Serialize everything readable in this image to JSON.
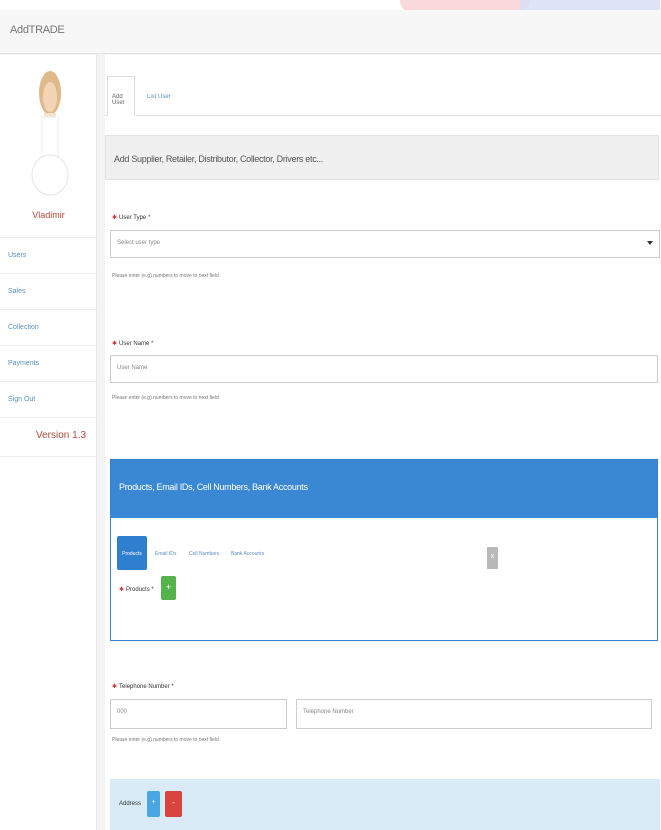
{
  "app": {
    "title": "AddTRADE"
  },
  "user": {
    "name": "Vladimir"
  },
  "sidebar": {
    "items": [
      {
        "label": "Users"
      },
      {
        "label": "Sales"
      },
      {
        "label": "Collection"
      },
      {
        "label": "Payments"
      },
      {
        "label": "Sign Out"
      }
    ],
    "version": "Version 1.3"
  },
  "tabs": [
    {
      "label": "Add User"
    },
    {
      "label": "List User"
    }
  ],
  "heading": "Add Supplier, Retailer, Distributor, Collector, Drivers etc...",
  "user_type": {
    "label": "User Type",
    "required": "*",
    "selected": "Select user type",
    "help": "Please enter (e.g) numbers to move to next field"
  },
  "user_name": {
    "label": "User Name",
    "required": "*",
    "placeholder": "User Name",
    "help": "Please enter (e.g) numbers to move to next field"
  },
  "panel": {
    "title": "Products, Email IDs, Cell Numbers, Bank Accounts",
    "tabs": [
      {
        "label": "Products"
      },
      {
        "label": "Email IDs"
      },
      {
        "label": "Cell Numbers"
      },
      {
        "label": "Bank Accounts"
      }
    ],
    "products_label": "Products",
    "products_required": "*",
    "plus": "+",
    "close": "x"
  },
  "telephone": {
    "label": "Telephone Number",
    "required": "*",
    "code_placeholder": "000",
    "number_placeholder": "Telephone Number",
    "help": "Please enter (e.g) numbers to move to next field"
  },
  "address": {
    "label": "Address",
    "add": "+",
    "remove": "-"
  },
  "colors": {
    "primary": "#3a87d4",
    "success": "#55b34d",
    "danger": "#d8433b",
    "info": "#49a6e4"
  }
}
